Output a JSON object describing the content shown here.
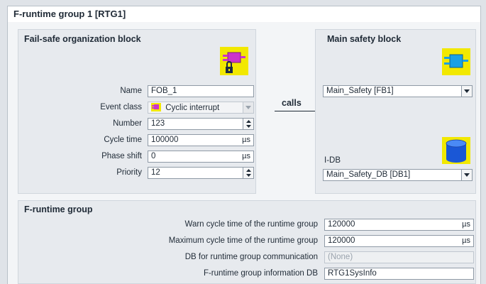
{
  "window": {
    "title": "F-runtime group 1 [RTG1]"
  },
  "fob": {
    "title": "Fail-safe organization block",
    "icon": "fob-locked-icon",
    "fields": {
      "name_label": "Name",
      "name_value": "FOB_1",
      "event_class_label": "Event class",
      "event_class_value": "Cyclic interrupt",
      "number_label": "Number",
      "number_value": "123",
      "cycle_time_label": "Cycle time",
      "cycle_time_value": "100000",
      "cycle_time_unit": "µs",
      "phase_shift_label": "Phase shift",
      "phase_shift_value": "0",
      "phase_shift_unit": "µs",
      "priority_label": "Priority",
      "priority_value": "12"
    }
  },
  "calls": {
    "label": "calls"
  },
  "main_safety": {
    "title": "Main safety block",
    "icon": "function-block-icon",
    "block_value": "Main_Safety [FB1]",
    "idb_label": "I-DB",
    "idb_icon": "database-icon",
    "idb_value": "Main_Safety_DB [DB1]"
  },
  "frg": {
    "title": "F-runtime group",
    "warn_label": "Warn cycle time of the runtime group",
    "warn_value": "120000",
    "warn_unit": "µs",
    "max_label": "Maximum cycle time of the runtime group",
    "max_value": "120000",
    "max_unit": "µs",
    "db_comm_label": "DB for runtime group communication",
    "db_comm_value": "(None)",
    "info_db_label": "F-runtime group information DB",
    "info_db_value": "RTG1SysInfo"
  },
  "colors": {
    "fb_yellow": "#f2e800",
    "fb_blue": "#1aa0e6",
    "fob_magenta": "#cc33cc",
    "db_blue": "#1a57d6"
  }
}
